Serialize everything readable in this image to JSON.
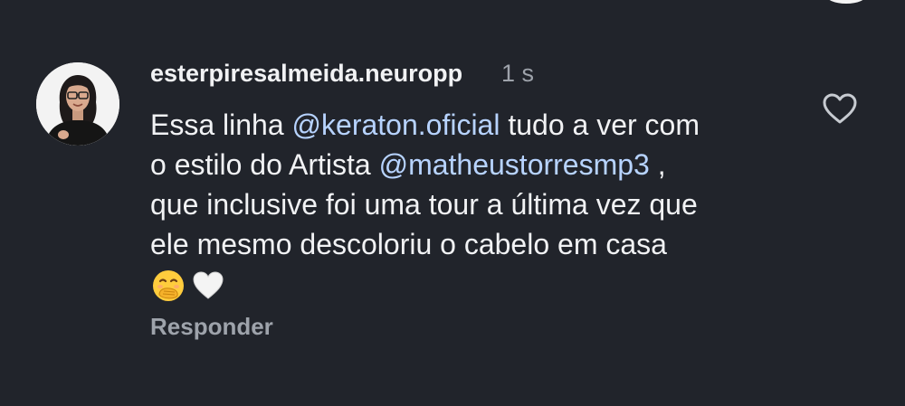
{
  "comment": {
    "username": "esterpiresalmeida.neuropp",
    "timestamp": "1 s",
    "text_parts": {
      "p1": "Essa linha ",
      "mention1": "@keraton.oficial",
      "p2": " tudo a ver com",
      "p3": "o estilo do Artista ",
      "mention2": "@matheustorresmp3",
      "p4": " ,",
      "p5": "que inclusive foi uma tour a última vez que",
      "p6": "ele mesmo descoloriu o cabelo em casa"
    },
    "emojis": [
      "face-with-hand-over-mouth-emoji",
      "white-heart-emoji"
    ],
    "reply_label": "Responder",
    "like_icon": "heart-outline-icon"
  },
  "colors": {
    "background": "#21242b",
    "text": "#f1f2f4",
    "secondary_text": "#9ea3ab",
    "mention": "#b7d3ff"
  }
}
